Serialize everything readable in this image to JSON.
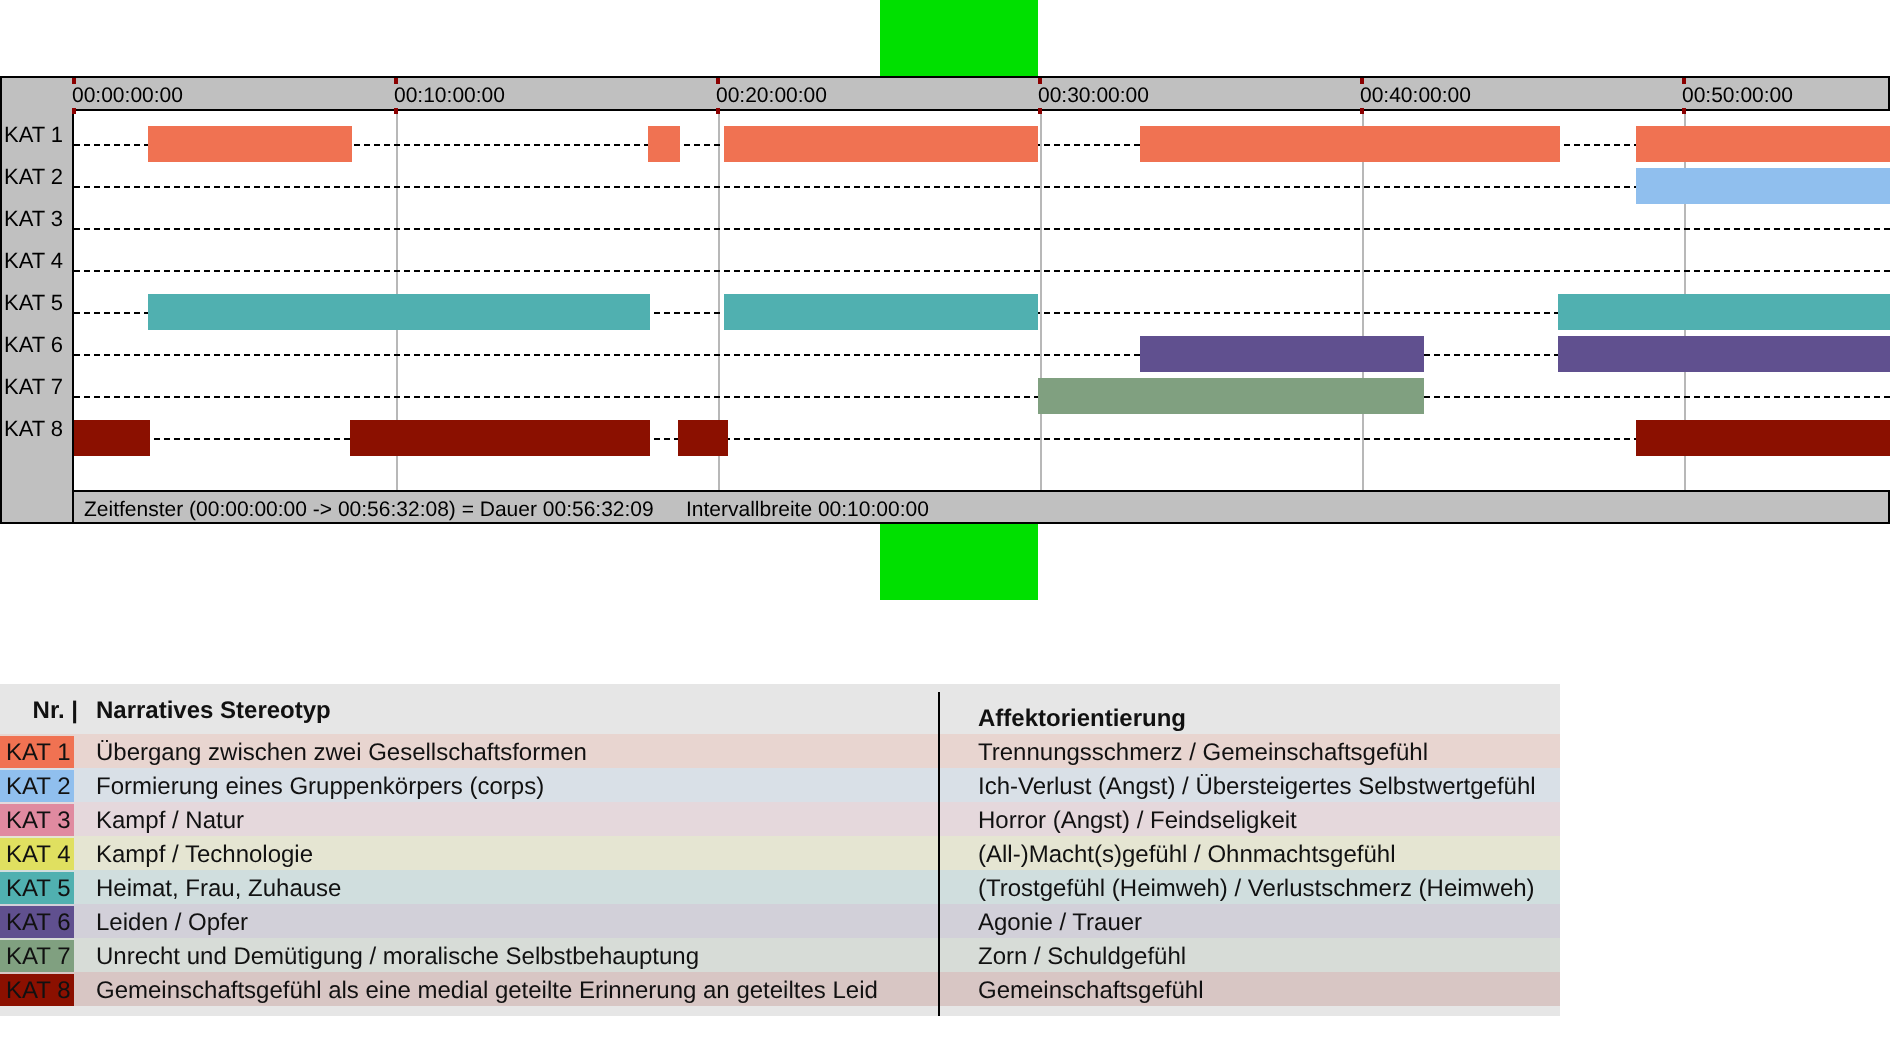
{
  "timeline": {
    "tick_labels": [
      "00:00:00:00",
      "00:10:00:00",
      "00:20:00:00",
      "00:30:00:00",
      "00:40:00:00",
      "00:50:00:00"
    ],
    "rows": [
      {
        "label": "KAT 1",
        "color": "#f07252"
      },
      {
        "label": "KAT 2",
        "color": "#90bfee"
      },
      {
        "label": "KAT 3"
      },
      {
        "label": "KAT 4"
      },
      {
        "label": "KAT 5",
        "color": "#50b0b0"
      },
      {
        "label": "KAT 6",
        "color": "#60508f"
      },
      {
        "label": "KAT 7",
        "color": "#80a080"
      },
      {
        "label": "KAT 8",
        "color": "#8b1000"
      }
    ],
    "footer": [
      "Zeitfenster (00:00:00:00 -> 00:56:32:08) = Dauer 00:56:32:09",
      "Intervallbreite 00:10:00:00"
    ]
  },
  "legend": {
    "columns": [
      "Nr. |",
      "Narratives Stereotyp",
      "Affektorientierung"
    ],
    "rows": [
      {
        "label": "KAT 1",
        "color": "#f07252",
        "stereotype": "Übergang zwischen zwei Gesellschaftsformen",
        "affect": "Trennungsschmerz / Gemeinschaftsgefühl"
      },
      {
        "label": "KAT 2",
        "color": "#90bfee",
        "stereotype": "Formierung eines Gruppenkörpers (corps)",
        "affect": "Ich-Verlust (Angst) / Übersteigertes Selbstwertgefühl"
      },
      {
        "label": "KAT 3",
        "color": "#e08aa0",
        "stereotype": "Kampf / Natur",
        "affect": "Horror (Angst) / Feindseligkeit"
      },
      {
        "label": "KAT 4",
        "color": "#e0e060",
        "stereotype": "Kampf / Technologie",
        "affect": "(All-)Macht(s)gefühl / Ohnmachtsgefühl"
      },
      {
        "label": "KAT 5",
        "color": "#50b0b0",
        "stereotype": "Heimat, Frau, Zuhause",
        "affect": "(Trostgefühl (Heimweh) / Verlustschmerz (Heimweh)"
      },
      {
        "label": "KAT 6",
        "color": "#60508f",
        "stereotype": "Leiden / Opfer",
        "affect": "Agonie / Trauer"
      },
      {
        "label": "KAT 7",
        "color": "#80a080",
        "stereotype": "Unrecht und Demütigung / moralische Selbstbehauptung",
        "affect": "Zorn / Schuldgefühl"
      },
      {
        "label": "KAT 8",
        "color": "#8b1000",
        "stereotype": "Gemeinschaftsgefühl als eine medial geteilte Erinnerung an geteiltes Leid",
        "affect": "Gemeinschaftsgefühl"
      }
    ]
  }
}
